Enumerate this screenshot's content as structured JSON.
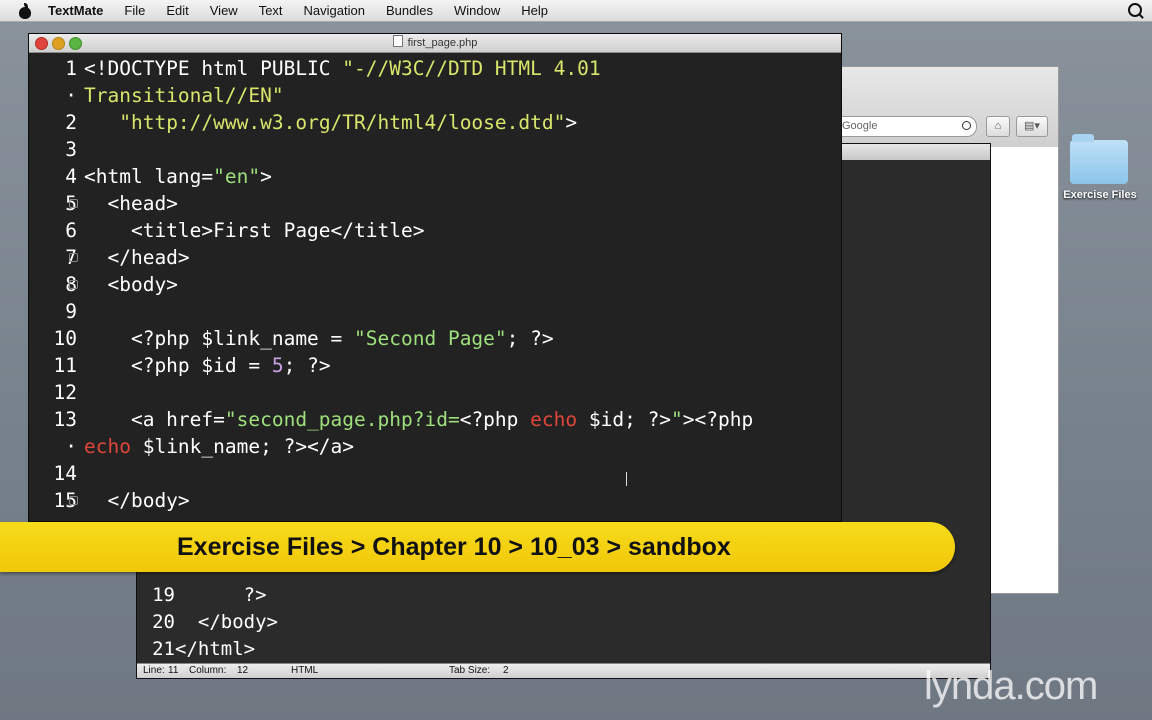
{
  "menubar": {
    "app": "TextMate",
    "items": [
      "File",
      "Edit",
      "View",
      "Text",
      "Navigation",
      "Bundles",
      "Window",
      "Help"
    ]
  },
  "desktop": {
    "folder_label": "Exercise Files"
  },
  "browser": {
    "search_placeholder": "Google"
  },
  "editor": {
    "title": "first_page.php",
    "lines": [
      {
        "n": "1",
        "fold": false
      },
      {
        "n": "·",
        "fold": false
      },
      {
        "n": "2",
        "fold": false
      },
      {
        "n": "3",
        "fold": false
      },
      {
        "n": "4",
        "fold": false
      },
      {
        "n": "5",
        "fold": true
      },
      {
        "n": "6",
        "fold": false
      },
      {
        "n": "7",
        "fold": true
      },
      {
        "n": "8",
        "fold": true
      },
      {
        "n": "9",
        "fold": false
      },
      {
        "n": "10",
        "fold": false
      },
      {
        "n": "11",
        "fold": false
      },
      {
        "n": "12",
        "fold": false
      },
      {
        "n": "13",
        "fold": false
      },
      {
        "n": "·",
        "fold": false
      },
      {
        "n": "14",
        "fold": false
      },
      {
        "n": "15",
        "fold": true
      }
    ],
    "code": {
      "l1a": "<!DOCTYPE html PUBLIC ",
      "l1b": "\"-//W3C//DTD HTML 4.01",
      "l1c": "Transitional//EN\"",
      "l2a": "   ",
      "l2b": "\"http://www.w3.org/TR/html4/loose.dtd\"",
      "l2c": ">",
      "l4a": "<html lang=",
      "l4b": "\"en\"",
      "l4c": ">",
      "l5": "  <head>",
      "l6": "    <title>First Page</title>",
      "l7": "  </head>",
      "l8": "  <body>",
      "l10a": "    <?php $link_name = ",
      "l10b": "\"Second Page\"",
      "l10c": "; ?>",
      "l11a": "    <?php $id = ",
      "l11b": "5",
      "l11c": "; ?>",
      "l13a": "    <a href=",
      "l13b": "\"second_page.php?id=",
      "l13c": "<?php ",
      "l13d": "echo",
      "l13e": " $id; ?>",
      "l13f": "\"",
      "l13g": "><?php",
      "l13h": "echo",
      "l13i": " $link_name; ?></a>",
      "l15": "  </body>"
    }
  },
  "editor2": {
    "lines": [
      {
        "n": "19",
        "text": "      ?>"
      },
      {
        "n": "20",
        "text": "  </body>"
      },
      {
        "n": "21",
        "text": "</html>"
      }
    ],
    "status": {
      "line": "Line:",
      "line_val": "11",
      "column": "Column:",
      "column_val": "12",
      "language": "HTML",
      "tab_size": "Tab Size:",
      "tab_val": "2"
    }
  },
  "banner": {
    "path": "Exercise Files > Chapter 10 > 10_03 > sandbox"
  },
  "watermark": "lynda.com"
}
